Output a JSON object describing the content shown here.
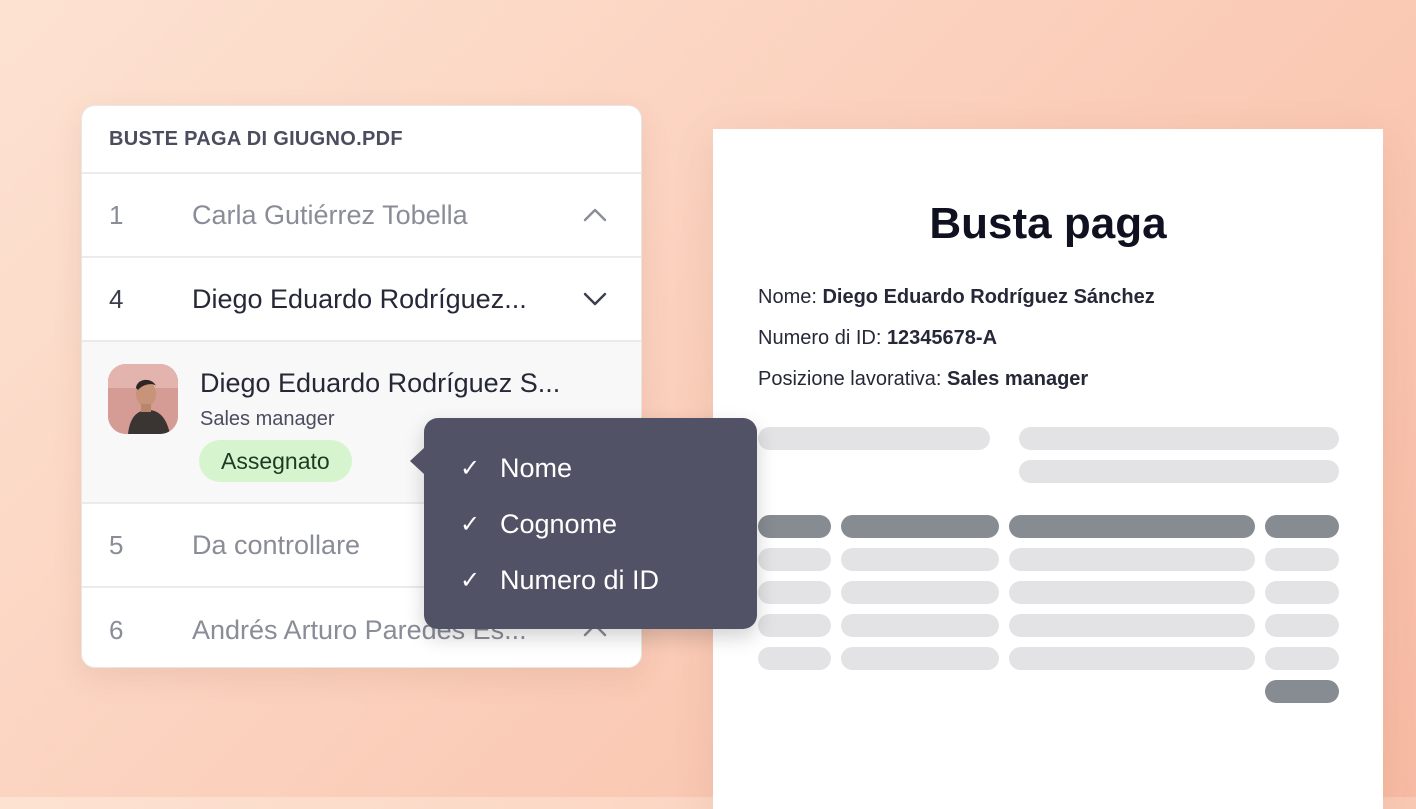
{
  "list": {
    "header": "BUSTE PAGA DI GIUGNO.PDF",
    "rows": [
      {
        "num": "1",
        "name": "Carla Gutiérrez Tobella",
        "chevron": "chevron-up-icon"
      },
      {
        "num": "4",
        "name": "Diego Eduardo Rodríguez...",
        "chevron": "chevron-down-icon"
      }
    ],
    "expanded": {
      "name": "Diego Eduardo Rodríguez S...",
      "role": "Sales manager",
      "status": "Assegnato"
    },
    "rows_after": [
      {
        "num": "5",
        "name": "Da controllare"
      },
      {
        "num": "6",
        "name": "Andrés Arturo Paredes Es...",
        "chevron": "chevron-up-icon"
      }
    ]
  },
  "tooltip": {
    "items": [
      {
        "check": "✓",
        "label": "Nome"
      },
      {
        "check": "✓",
        "label": "Cognome"
      },
      {
        "check": "✓",
        "label": "Numero di ID"
      }
    ]
  },
  "document": {
    "title": "Busta paga",
    "fields": [
      {
        "label": "Nome:",
        "value": "Diego Eduardo Rodríguez Sánchez"
      },
      {
        "label": "Numero di ID:",
        "value": "12345678-A"
      },
      {
        "label": "Posizione lavorativa:",
        "value": "Sales manager"
      }
    ]
  },
  "colors": {
    "tooltip_bg": "#515266",
    "badge_bg": "#d6f5cf",
    "placeholder_light": "#e3e3e5",
    "placeholder_dark": "#878c93"
  }
}
